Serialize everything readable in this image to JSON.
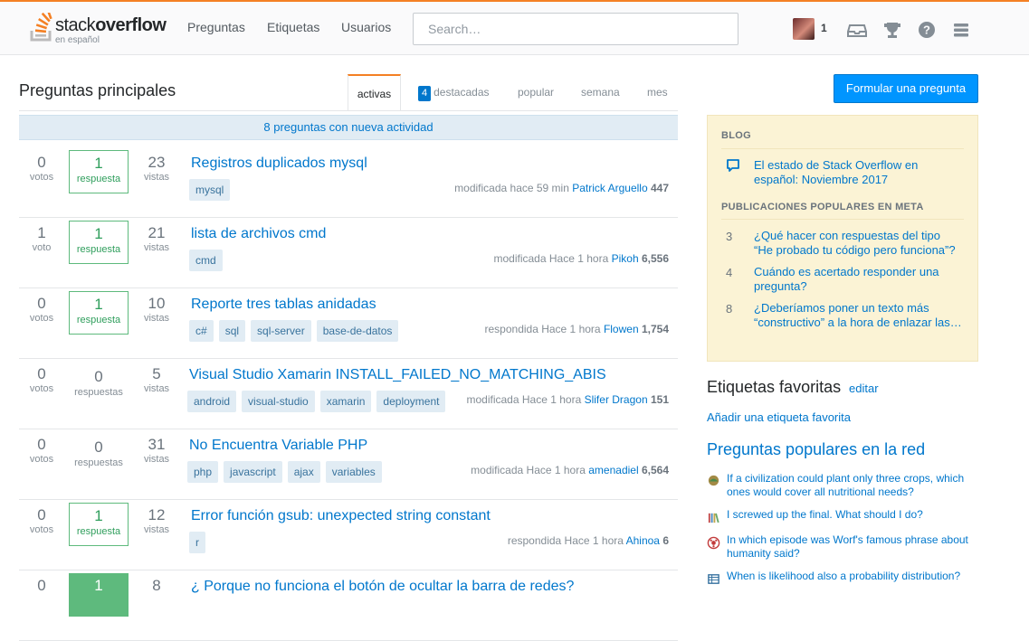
{
  "header": {
    "logo_name": "stack",
    "logo_name_bold": "overflow",
    "logo_sub": "en español",
    "nav": [
      "Preguntas",
      "Etiquetas",
      "Usuarios"
    ],
    "search_placeholder": "Search…",
    "reputation": "1",
    "icons": [
      "inbox-icon",
      "achievements-icon",
      "help-icon",
      "site-switcher-icon"
    ],
    "accent": "#f48024"
  },
  "main": {
    "title": "Preguntas principales",
    "tabs": [
      {
        "label": "activas",
        "active": true
      },
      {
        "label": "destacadas",
        "badge": "4"
      },
      {
        "label": "popular"
      },
      {
        "label": "semana"
      },
      {
        "label": "mes"
      }
    ],
    "new_activity": "8 preguntas con nueva actividad",
    "questions": [
      {
        "votes": "0",
        "votes_label": "votos",
        "answers": "1",
        "answers_label": "respuesta",
        "answer_state": "answered",
        "views": "23",
        "views_label": "vistas",
        "title": "Registros duplicados mysql",
        "tags": [
          "mysql"
        ],
        "action": "modificada hace 59 min",
        "user": "Patrick Arguello",
        "rep": "447"
      },
      {
        "votes": "1",
        "votes_label": "voto",
        "answers": "1",
        "answers_label": "respuesta",
        "answer_state": "answered",
        "views": "21",
        "views_label": "vistas",
        "title": "lista de archivos cmd",
        "tags": [
          "cmd"
        ],
        "action": "modificada Hace 1 hora",
        "user": "Pikoh",
        "rep": "6,556"
      },
      {
        "votes": "0",
        "votes_label": "votos",
        "answers": "1",
        "answers_label": "respuesta",
        "answer_state": "answered",
        "views": "10",
        "views_label": "vistas",
        "title": "Reporte tres tablas anidadas",
        "tags": [
          "c#",
          "sql",
          "sql-server",
          "base-de-datos"
        ],
        "action": "respondida Hace 1 hora",
        "user": "Flowen",
        "rep": "1,754"
      },
      {
        "votes": "0",
        "votes_label": "votos",
        "answers": "0",
        "answers_label": "respuestas",
        "answer_state": "none",
        "views": "5",
        "views_label": "vistas",
        "title": "Visual Studio Xamarin INSTALL_FAILED_NO_MATCHING_ABIS",
        "tags": [
          "android",
          "visual-studio",
          "xamarin",
          "deployment"
        ],
        "action": "modificada Hace 1 hora",
        "user": "Slifer Dragon",
        "rep": "151"
      },
      {
        "votes": "0",
        "votes_label": "votos",
        "answers": "0",
        "answers_label": "respuestas",
        "answer_state": "none",
        "views": "31",
        "views_label": "vistas",
        "title": "No Encuentra Variable PHP",
        "tags": [
          "php",
          "javascript",
          "ajax",
          "variables"
        ],
        "action": "modificada Hace 1 hora",
        "user": "amenadiel",
        "rep": "6,564"
      },
      {
        "votes": "0",
        "votes_label": "votos",
        "answers": "1",
        "answers_label": "respuesta",
        "answer_state": "answered",
        "views": "12",
        "views_label": "vistas",
        "title": "Error función gsub: unexpected string constant",
        "tags": [
          "r"
        ],
        "action": "respondida Hace 1 hora",
        "user": "Ahinoa",
        "rep": "6"
      },
      {
        "votes": "0",
        "votes_label": "",
        "answers": "1",
        "answers_label": "",
        "answer_state": "accepted",
        "views": "8",
        "views_label": "",
        "title": "¿ Porque no funciona el botón de ocultar la barra de redes?",
        "tags": [],
        "action": "",
        "user": "",
        "rep": ""
      }
    ]
  },
  "sidebar": {
    "ask_button": "Formular una pregunta",
    "blog_heading": "BLOG",
    "blog_post": "El estado de Stack Overflow en español: Noviembre 2017",
    "meta_heading": "PUBLICACIONES POPULARES EN META",
    "meta_posts": [
      {
        "count": "3",
        "title": "¿Qué hacer con respuestas del tipo “He probado tu código pero funciona”?"
      },
      {
        "count": "4",
        "title": "Cuándo es acertado responder una pregunta?"
      },
      {
        "count": "8",
        "title": "¿Deberíamos poner un texto más “constructivo” a la hora de enlazar las…"
      }
    ],
    "favorites_heading": "Etiquetas favoritas",
    "favorites_edit": "editar",
    "favorites_add": "Añadir una etiqueta favorita",
    "hot_heading": "Preguntas populares en la red",
    "hot_questions": [
      {
        "icon": "worldbuilding-icon",
        "title": "If a civilization could plant only three crops, which ones would cover all nutritional needs?"
      },
      {
        "icon": "academia-icon",
        "title": "I screwed up the final. What should I do?"
      },
      {
        "icon": "scifi-icon",
        "title": "In which episode was Worf's famous phrase about humanity said?"
      },
      {
        "icon": "stats-icon",
        "title": "When is likelihood also a probability distribution?"
      }
    ]
  }
}
